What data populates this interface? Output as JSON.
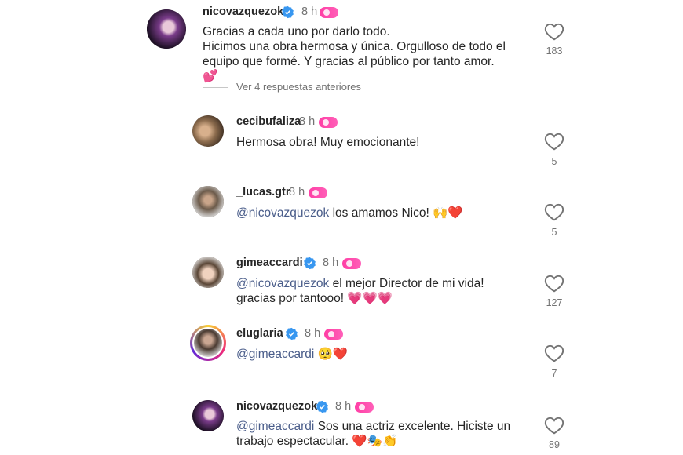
{
  "comments": [
    {
      "username": "nicovazquezok",
      "verified": true,
      "time": "8 h",
      "text_lines": [
        "Gracias a cada uno por darlo todo.",
        "Hicimos una obra hermosa y única. Orgulloso de todo el",
        "equipo que formé. Y gracias al público por tanto amor."
      ],
      "trailing_emoji": "💕",
      "likes": "183"
    },
    {
      "username": "cecibufaliza",
      "verified": false,
      "time": "8 h",
      "text": "Hermosa obra! Muy emocionante!",
      "likes": "5"
    },
    {
      "username": "_lucas.gtr",
      "verified": false,
      "time": "8 h",
      "mention": "@nicovazquezok",
      "text": " los amamos Nico! 🙌❤️",
      "likes": "5"
    },
    {
      "username": "gimeaccardi",
      "verified": true,
      "time": "8 h",
      "mention": "@nicovazquezok",
      "text": " el mejor Director de mi vida!",
      "text2": "gracias por tantooo! 💗💗💗",
      "likes": "127"
    },
    {
      "username": "eluglaria",
      "verified": true,
      "time": "8 h",
      "mention": "@gimeaccardi",
      "text": " 🥺❤️",
      "likes": "7"
    },
    {
      "username": "nicovazquezok",
      "verified": true,
      "time": "8 h",
      "mention": "@gimeaccardi",
      "text": " Sos una actriz excelente. Hiciste un",
      "text2": "trabajo espectacular. ❤️🎭👏",
      "likes": "89"
    }
  ],
  "view_replies": "Ver 4 respuestas anteriores",
  "colors": {
    "verified": "#3897f0",
    "badge": "#ff3ea5",
    "mention": "#4a5d8a",
    "muted": "#737373"
  }
}
